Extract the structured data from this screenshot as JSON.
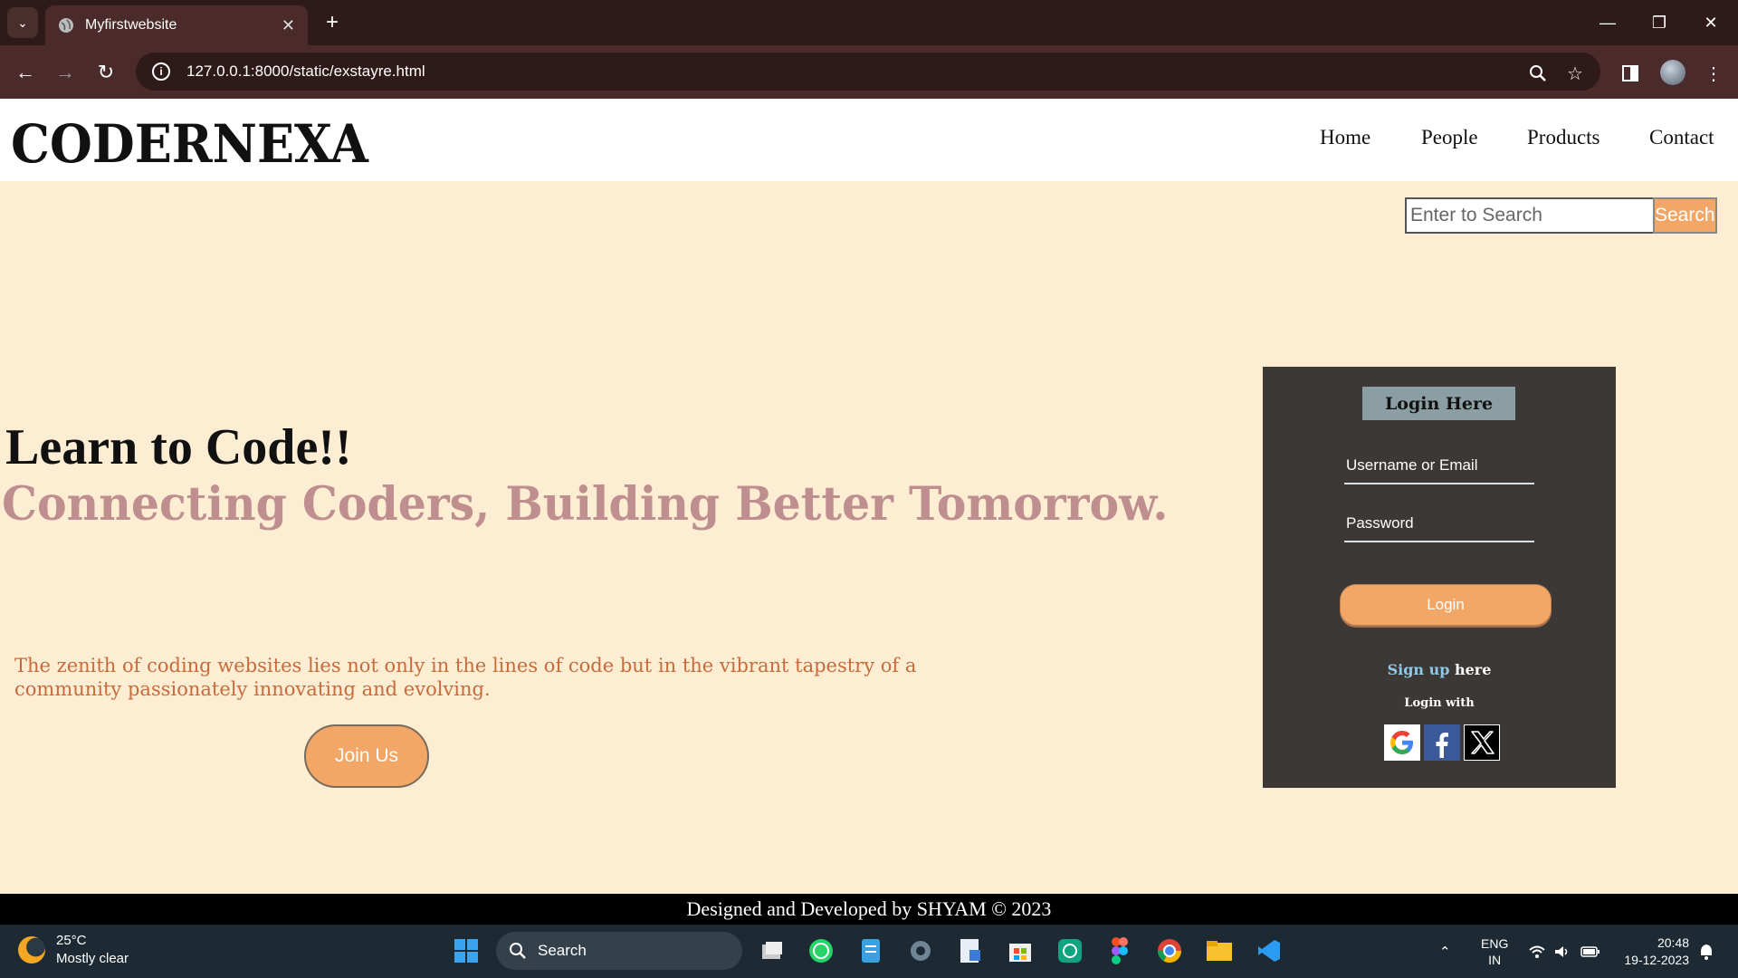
{
  "browser": {
    "tab_title": "Myfirstwebsite",
    "url": "127.0.0.1:8000/static/exstayre.html"
  },
  "site": {
    "logo": "CODERNEXA",
    "nav": [
      "Home",
      "People",
      "Products",
      "Contact"
    ],
    "search_placeholder": "Enter to Search",
    "search_button": "Search"
  },
  "hero": {
    "title": "Learn to Code!!",
    "subtitle": "Connecting Coders, Building Better Tomorrow.",
    "paragraph": "The zenith of coding websites lies not only in the lines of code but in the vibrant tapestry of a community passionately innovating and evolving.",
    "join_button": "Join Us"
  },
  "login": {
    "heading": "Login Here",
    "username_placeholder": "Username or Email",
    "password_placeholder": "Password",
    "login_button": "Login",
    "signup_link": "Sign up",
    "signup_suffix": " here",
    "login_with": "Login with"
  },
  "footer": {
    "text": "Designed and Developed by SHYAM © 2023"
  },
  "taskbar": {
    "temperature": "25°C",
    "weather": "Mostly clear",
    "search_label": "Search",
    "language": "ENG",
    "region": "IN",
    "time": "20:48",
    "date": "19-12-2023"
  },
  "colors": {
    "page_bg": "#fdeed3",
    "accent_orange": "#f3a767",
    "subtitle_color": "#bf8f8f",
    "paragraph_color": "#c76a3c",
    "card_bg": "#3b3835",
    "chrome_bg": "#2f1a1a"
  }
}
